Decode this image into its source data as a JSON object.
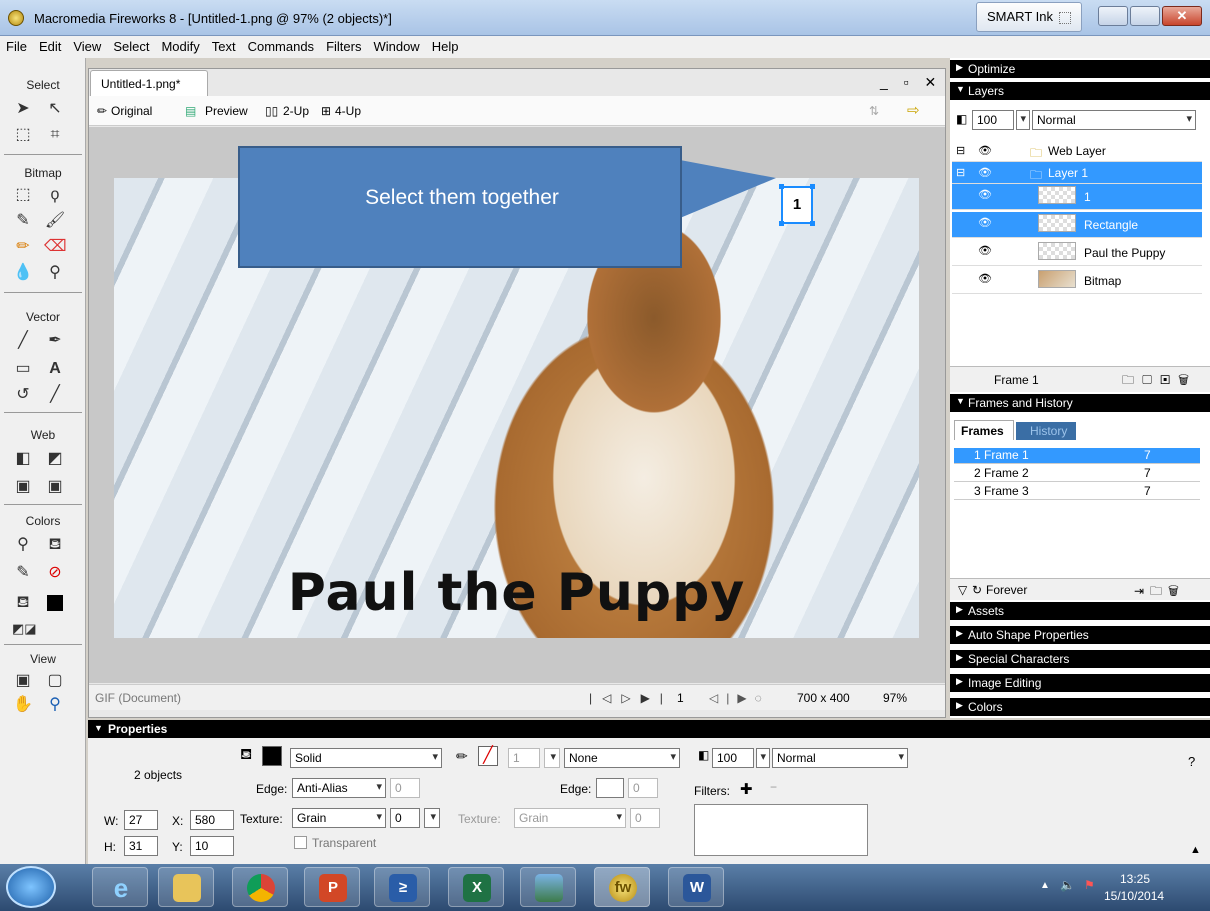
{
  "window": {
    "title": "Macromedia Fireworks 8 - [Untitled-1.png @ 97% (2 objects)*]",
    "smart_ink": "SMART Ink"
  },
  "menu": [
    "File",
    "Edit",
    "View",
    "Select",
    "Modify",
    "Text",
    "Commands",
    "Filters",
    "Window",
    "Help"
  ],
  "toolbar": {
    "sections": [
      "Select",
      "Bitmap",
      "Vector",
      "Web",
      "Colors",
      "View"
    ]
  },
  "document": {
    "tab": "Untitled-1.png*",
    "views": [
      "Original",
      "Preview",
      "2-Up",
      "4-Up"
    ],
    "callout": "Select them together",
    "caption": "Paul the Puppy",
    "selected_text": "1",
    "status": {
      "format": "GIF (Document)",
      "frame": "1",
      "size": "700 x 400",
      "zoom": "97%"
    }
  },
  "panels": {
    "optimize": "Optimize",
    "layers": {
      "title": "Layers",
      "opacity": "100",
      "blend": "Normal",
      "rows": [
        {
          "name": "Web Layer",
          "sel": false
        },
        {
          "name": "Layer 1",
          "sel": true
        },
        {
          "name": "1",
          "sel": true
        },
        {
          "name": "Rectangle",
          "sel": true
        },
        {
          "name": "Paul the Puppy",
          "sel": false
        },
        {
          "name": "Bitmap",
          "sel": false
        }
      ],
      "footer": "Frame 1"
    },
    "frames": {
      "title": "Frames and History",
      "tabs": [
        "Frames",
        "History"
      ],
      "rows": [
        {
          "name": "1  Frame 1",
          "delay": "7"
        },
        {
          "name": "2  Frame 2",
          "delay": "7"
        },
        {
          "name": "3  Frame 3",
          "delay": "7"
        }
      ],
      "loop": "Forever"
    },
    "collapsed": [
      "Assets",
      "Auto Shape Properties",
      "Special Characters",
      "Image Editing",
      "Colors"
    ]
  },
  "properties": {
    "title": "Properties",
    "summary": "2 objects",
    "w": "27",
    "h": "31",
    "x": "580",
    "y": "10",
    "fill": "Solid",
    "edge_label": "Edge:",
    "edge": "Anti-Alias",
    "edge_val": "0",
    "texture_label": "Texture:",
    "texture": "Grain",
    "texture_val": "0",
    "transparent": "Transparent",
    "stroke_size": "1",
    "stroke": "None",
    "stroke_edge_val": "0",
    "stroke_texture": "Grain",
    "stroke_texture_val": "0",
    "opacity": "100",
    "blend": "Normal",
    "filters": "Filters:"
  },
  "taskbar": {
    "time": "13:25",
    "date": "15/10/2014"
  }
}
